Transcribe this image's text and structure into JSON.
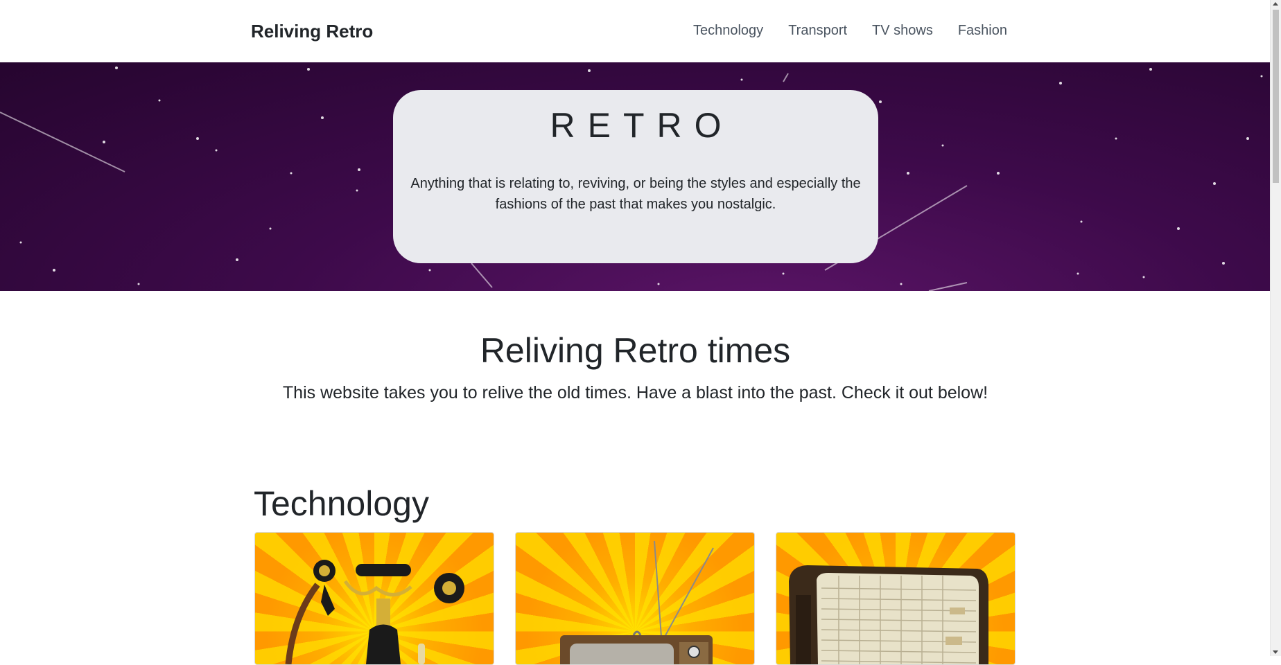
{
  "nav": {
    "brand": "Reliving Retro",
    "links": [
      "Technology",
      "Transport",
      "TV shows",
      "Fashion"
    ]
  },
  "hero": {
    "title": "RETRO",
    "text": "Anything that is relating to, reviving, or being the styles and especially the fashions of the past that makes you nostalgic."
  },
  "intro": {
    "title": "Reliving Retro times",
    "text": "This website takes you to relive the old times. Have a blast into the past. Check it out below!"
  },
  "sections": [
    {
      "title": "Technology",
      "cards": [
        {
          "image": "telephone-image"
        },
        {
          "image": "television-image"
        },
        {
          "image": "radio-image"
        }
      ]
    }
  ],
  "colors": {
    "hero_bg": "#3d0a4a",
    "hero_card": "#e9eaee",
    "card_yellow": "#ffcc00",
    "card_orange": "#ff9900"
  }
}
